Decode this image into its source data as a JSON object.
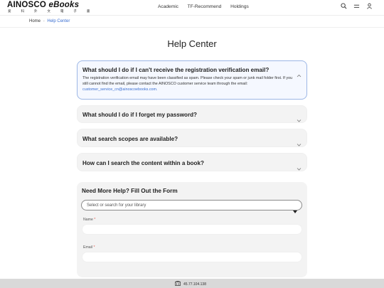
{
  "header": {
    "logo_main": "AINOSCO",
    "logo_ebooks": "eBooks",
    "logo_sub": "爱 科 外 文 電 子 書",
    "nav": [
      "Academic",
      "TF-Recommend",
      "Holdings"
    ],
    "icons": [
      "search-icon",
      "menu-icon",
      "user-icon"
    ]
  },
  "breadcrumb": {
    "home": "Home",
    "separator": "-",
    "current": "Help Center"
  },
  "page_title": "Help Center",
  "faq": [
    {
      "question": "What should I do if I can't receive the registration verification email?",
      "expanded": true,
      "answer": "The registration verification email may have been classified as spam. Please check your spam or junk mail folder first. If you still cannot find the email, please contact the AINOSCO customer service team through the email:",
      "answer_email": "customer_service_cn@ainoscoebooks.com."
    },
    {
      "question": "What should I do if I forget my password?",
      "expanded": false
    },
    {
      "question": "What search scopes are available?",
      "expanded": false
    },
    {
      "question": "How can I search the content within a book?",
      "expanded": false
    }
  ],
  "form": {
    "title": "Need More Help? Fill Out the Form",
    "library_placeholder": "Select or search for your library",
    "name_label": "Name",
    "email_label": "Email",
    "required_mark": "*"
  },
  "footer": {
    "ip": "45.77.104.138"
  },
  "colors": {
    "accent": "#3a6fd1",
    "required": "#e2574c",
    "card_bg": "#f3f3f3"
  }
}
